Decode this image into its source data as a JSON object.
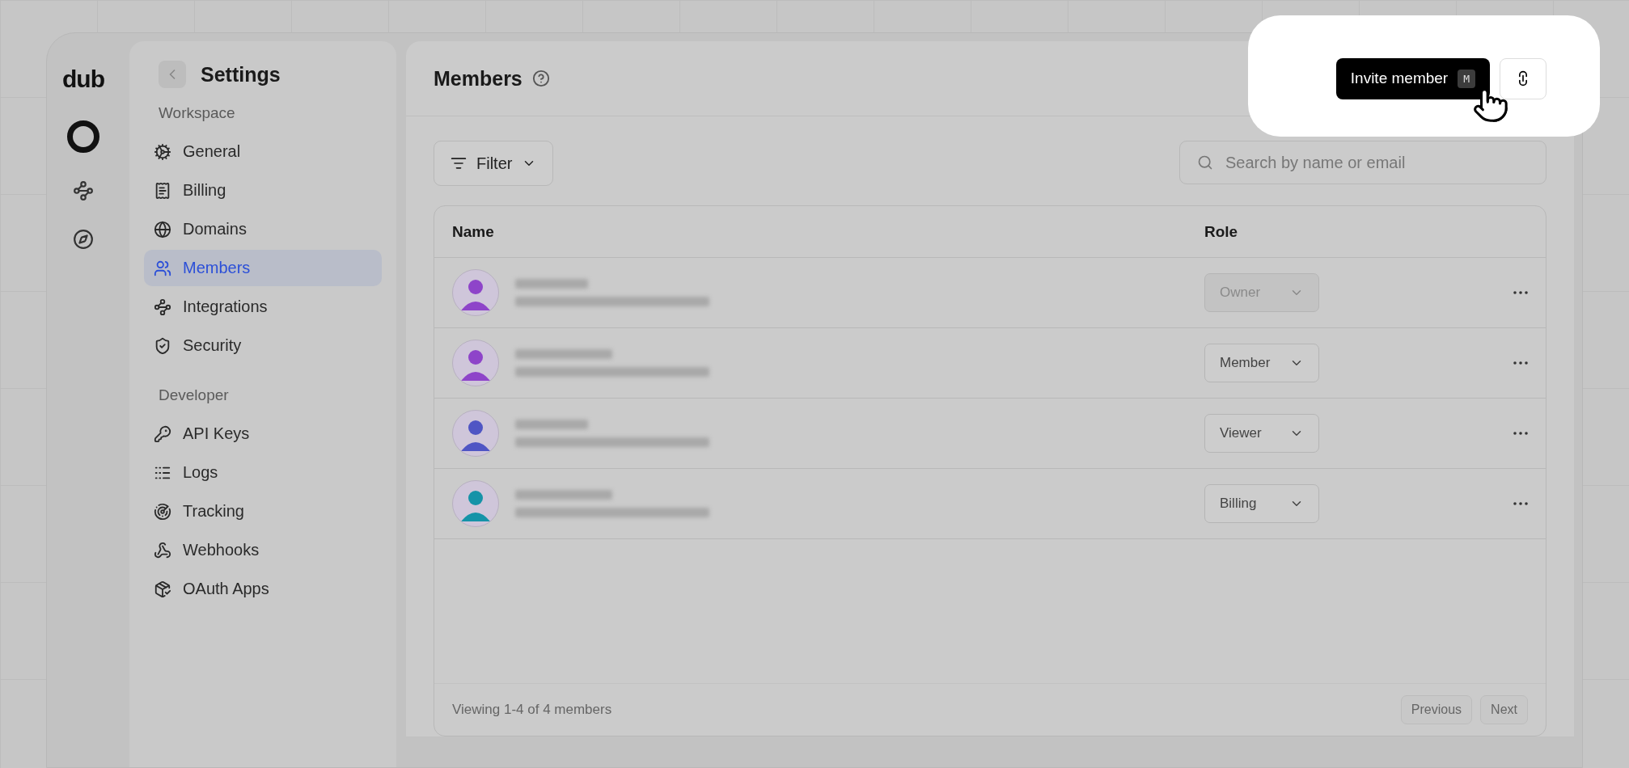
{
  "logo": "dub",
  "sidebar": {
    "title": "Settings",
    "sections": [
      {
        "heading": "Workspace",
        "items": [
          {
            "label": "General",
            "selected": false
          },
          {
            "label": "Billing",
            "selected": false
          },
          {
            "label": "Domains",
            "selected": false
          },
          {
            "label": "Members",
            "selected": true
          },
          {
            "label": "Integrations",
            "selected": false
          },
          {
            "label": "Security",
            "selected": false
          }
        ]
      },
      {
        "heading": "Developer",
        "items": [
          {
            "label": "API Keys",
            "selected": false
          },
          {
            "label": "Logs",
            "selected": false
          },
          {
            "label": "Tracking",
            "selected": false
          },
          {
            "label": "Webhooks",
            "selected": false
          },
          {
            "label": "OAuth Apps",
            "selected": false
          }
        ]
      }
    ]
  },
  "page": {
    "title": "Members",
    "invite_button": {
      "label": "Invite member",
      "shortcut": "M"
    }
  },
  "filter": {
    "label": "Filter"
  },
  "search": {
    "placeholder": "Search by name or email"
  },
  "table": {
    "columns": [
      "Name",
      "Role"
    ],
    "rows": [
      {
        "color": "#8e44c9",
        "role": "Owner",
        "disabled": true
      },
      {
        "color": "#8e44c9",
        "role": "Member",
        "disabled": false
      },
      {
        "color": "#4f55c4",
        "role": "Viewer",
        "disabled": false
      },
      {
        "color": "#1593a8",
        "role": "Billing",
        "disabled": false
      }
    ]
  },
  "footer": {
    "summary": "Viewing 1-4 of 4 members",
    "previous": "Previous",
    "next": "Next"
  }
}
